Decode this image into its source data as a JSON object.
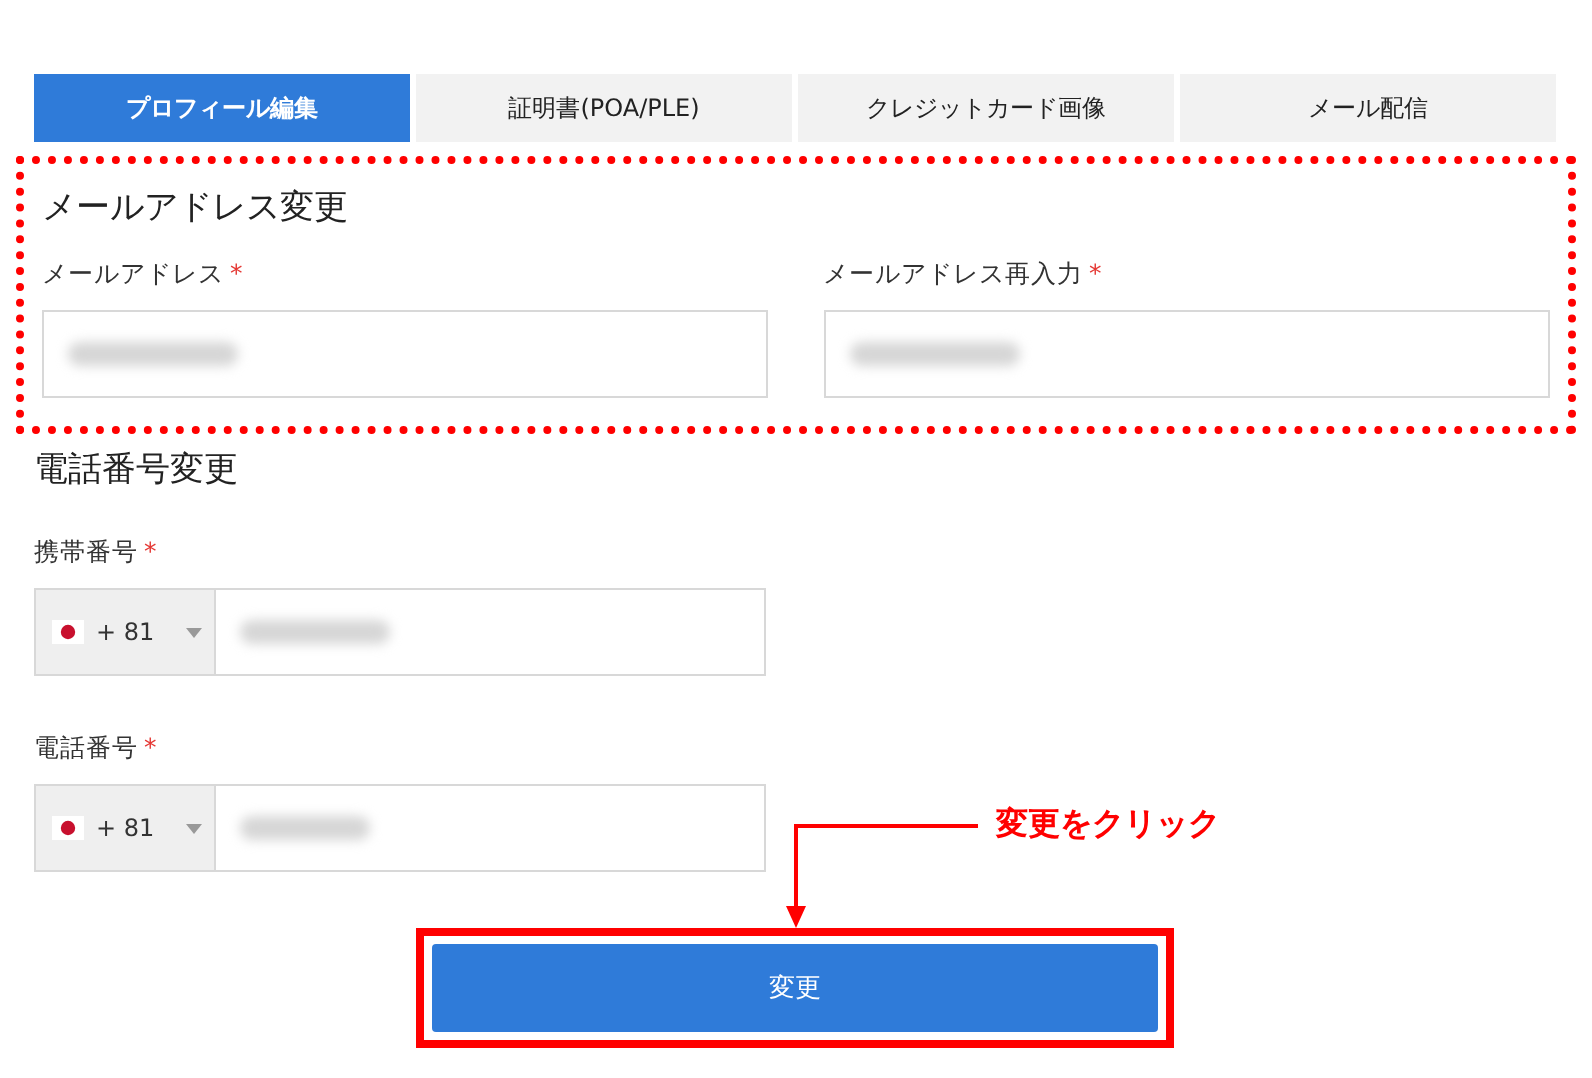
{
  "tabs": [
    {
      "label": "プロフィール編集",
      "selected": true
    },
    {
      "label": "証明書(POA/PLE)",
      "selected": false
    },
    {
      "label": "クレジットカード画像",
      "selected": false
    },
    {
      "label": "メール配信",
      "selected": false
    }
  ],
  "email_section": {
    "title": "メールアドレス変更",
    "highlighted": true,
    "fields": [
      {
        "label": "メールアドレス",
        "required_mark": "*"
      },
      {
        "label": "メールアドレス再入力",
        "required_mark": "*"
      }
    ]
  },
  "phone_section": {
    "title": "電話番号変更",
    "fields": [
      {
        "label": "携帯番号",
        "required_mark": "*",
        "country_code": "+ 81"
      },
      {
        "label": "電話番号",
        "required_mark": "*",
        "country_code": "+ 81"
      }
    ]
  },
  "submit_button": {
    "label": "変更",
    "highlighted": true
  },
  "annotation": {
    "text": "変更をクリック"
  }
}
